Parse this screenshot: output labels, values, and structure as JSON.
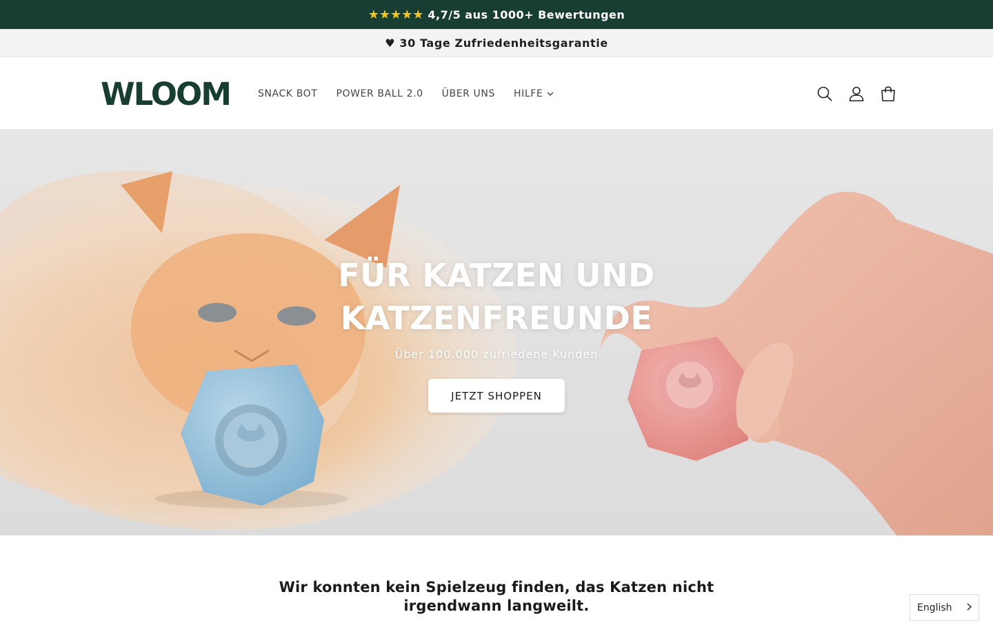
{
  "announcement": {
    "stars": "★★★★★",
    "rating_text": "4,7/5 aus 1000+ Bewertungen"
  },
  "sub_announcement": {
    "text": "♥ 30 Tage Zufriedenheitsgarantie"
  },
  "header": {
    "logo": "WLOOM",
    "nav": [
      {
        "label": "SNACK BOT"
      },
      {
        "label": "POWER BALL 2.0"
      },
      {
        "label": "ÜBER UNS"
      },
      {
        "label": "HILFE"
      }
    ],
    "icons": [
      "search-icon",
      "account-icon",
      "cart-icon"
    ]
  },
  "hero": {
    "title_line1": "FÜR KATZEN UND",
    "title_line2": "KATZENFREUNDE",
    "subtitle": "Über 100.000 zufriedene Kunden",
    "cta": "JETZT SHOPPEN"
  },
  "intro": {
    "text": "Wir konnten kein Spielzeug finden, das Katzen nicht irgendwann langweilt."
  },
  "language_selector": {
    "value": "English"
  },
  "colors": {
    "brand_green": "#183d33",
    "star_yellow": "#f5c518",
    "hero_bg": "#e3e3e3",
    "ball_blue": "#9ec5de",
    "ball_pink": "#e99a9a"
  }
}
